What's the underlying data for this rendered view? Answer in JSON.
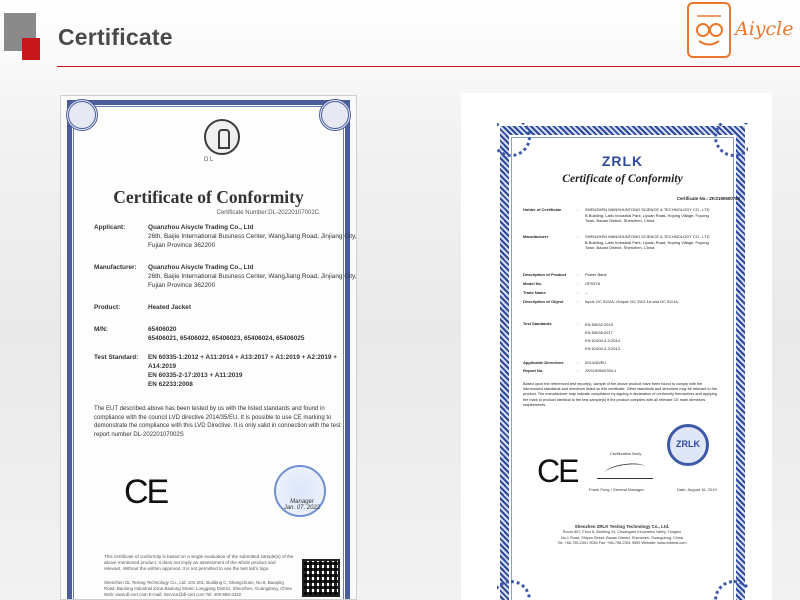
{
  "header": {
    "title": "Certificate",
    "brand_name": "Aiycle",
    "accent": "#c8161d",
    "brand_color": "#e9782e"
  },
  "cert_left": {
    "seal_text": "D L",
    "title": "Certificate of Conformity",
    "number": "Certificate Number:DL-20220107002C",
    "applicant_label": "Applicant:",
    "applicant_name": "Quanzhou Aisycle Trading Co., Ltd",
    "applicant_addr1": "26th, Baijie International Business Center, WangJiang Road, Jinjiang City,",
    "applicant_addr2": "Fujian Province 362200",
    "manufacturer_label": "Manufacturer:",
    "manufacturer_name": "Quanzhou Aisycle Trading Co., Ltd",
    "manufacturer_addr1": "26th, Baijie International Business Center, WangJiang Road, Jinjiang City,",
    "manufacturer_addr2": "Fujian Province 362200",
    "product_label": "Product:",
    "product_value": "Heated Jacket",
    "mn_label": "M/N:",
    "mn_value1": "65406020",
    "mn_value2": "65406021, 65406022, 65406023, 65406024, 65406025",
    "standard_label": "Test Standard:",
    "standard1": "EN 60335-1:2012 + A11:2014 + A13:2017 + A1:2019 + A2:2019 + A14:2019",
    "standard2": "EN 60335-2-17:2013 + A11:2019",
    "standard3": "EN 62233:2008",
    "paragraph": "The EUT described above has been tested by us with the listed standards and found in compliance with the council LVD directive 2014/35/EU. It is possible to use CE marking to demonstrate the compliance with this LVD Directive. It is only valid in connection with the test report number DL-20220107002S",
    "ce_mark": "CE",
    "stamp_name": "Manager",
    "stamp_date": "Jan. 07, 2022",
    "footer1": "This certificate of conformity is based on a single evaluation of the submitted sample(s) of the above mentioned product. It does not imply an assessment of the whole product and relevant. Without the written approval. It is not permitted to use the test lab's logo.",
    "footer2": "Shenzhen DL Testing Technology Co., Ltd. 101-201, Building C, Shangchuan, No.8, Baoqing Road, Baolong Industrial Zone,Baolong Street, Longgang District, Shenzhen, Guangdong, China",
    "footer3": "Web: www.dl-cert.com    E-mail: Service@dl-cert.com    Tel: 400-688-3332"
  },
  "cert_right": {
    "logo": "ZRLK",
    "title": "Certificate of Conformity",
    "number": "Certificate No.: ZKS190600784",
    "holder_label": "Holder of Certificate",
    "holder1": "SHENZHEN WANSHUNTONG SCIENCE & TECHNOLOGY CO., LTD",
    "holder2": "B Building, Laifu Industrial Park, Liyuan Road, Hoping Village, Fuyong",
    "holder3": "Town, Baoan District, Shenzhen, China",
    "manufacturer_label": "Manufacturer",
    "manufacturer1": "SHENZHEN WANSHUNTONG SCIENCE & TECHNOLOGY CO., LTD",
    "manufacturer2": "B Building, Laifu Industrial Park, Liyuan Road, Hoping Village, Fuyong",
    "manufacturer3": "Town, Baoan District, Shenzhen, China",
    "product_label": "Description of Product",
    "product_value": "Power Bank",
    "model_label": "Model No.",
    "model_value": "OP037A",
    "trade_label": "Trade Name",
    "trade_value": "--",
    "object_label": "Description of Object",
    "object_value": "Input: DC 5V/2A, Output: DC 5V/2.1A and DC 5V/1A",
    "standards_label": "Test Standards",
    "std1": "EN 55032:2015",
    "std2": "EN 55035:2017",
    "std3": "EN 61000-3-2:2014",
    "std4": "EN 61000-3-3:2013",
    "directives_label": "Applicable Directives",
    "directives_value": "2014/30/EU",
    "report_label": "Report No.",
    "report_value": "ZKS190600784-1",
    "paragraph": "Based upon the referenced test report(s), sample of the above product have been found to comply with the harmonized standards and directives listed on this certificate. Other standards and directives may be relevant to the product. The manufacturer may indicate compliance by signing a declaration of conformity themselves and applying the mark to product identical to the test sample(s) if the product complies with all relevant CE mark directives requirements.",
    "ce_mark": "CE",
    "cert_body": "Certification Body",
    "signer": "Frank Feng / General Manager",
    "date": "Date: August 16, 2019",
    "seal": "ZRLK",
    "footer1": "Shenzhen ZRLK Testing Technology Co., Ltd.",
    "footer2": "Room 807, Floor 8, Building 24, Chuangwei Innovation Valley, Tangtou",
    "footer3": "No.1 Road, Shiyan Street, Baoan District, Shenzhen, Guangdong, China",
    "footer4": "Tel: +86-755-2301 9036     Fax: +86-755-2301 9599     Website: www.zrlktest.com"
  }
}
